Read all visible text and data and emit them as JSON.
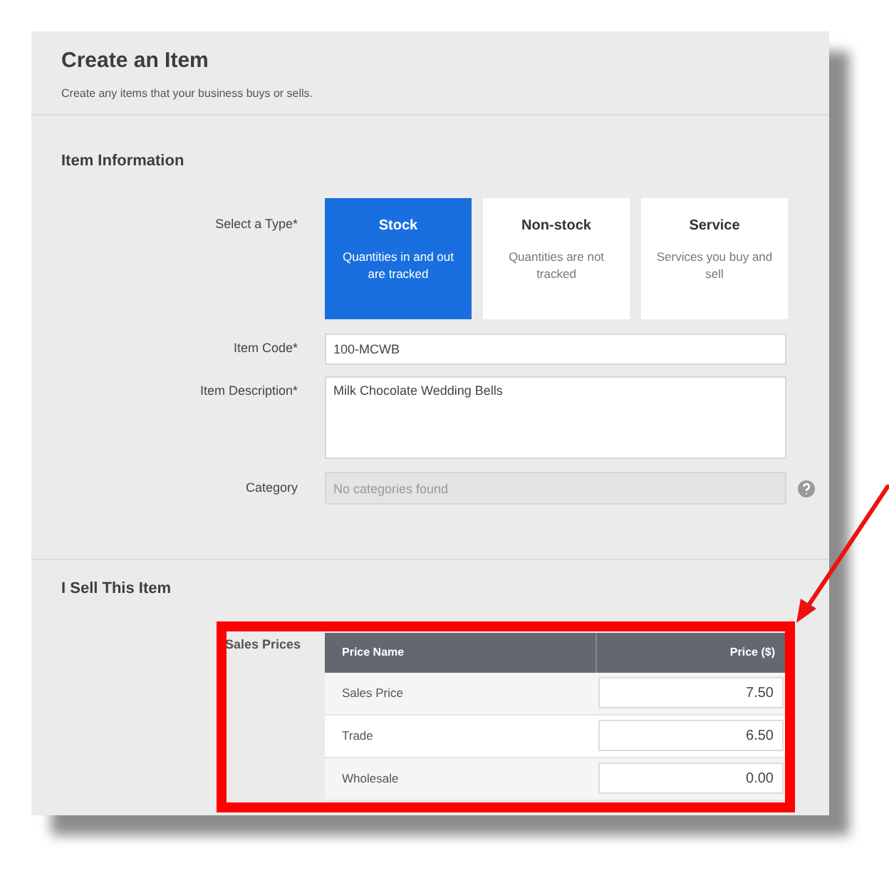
{
  "header": {
    "title": "Create an Item",
    "subtitle": "Create any items that your business buys or sells."
  },
  "item_information": {
    "heading": "Item Information",
    "type_label": "Select a Type*",
    "types": [
      {
        "title": "Stock",
        "description": "Quantities in and out are tracked",
        "selected": true
      },
      {
        "title": "Non-stock",
        "description": "Quantities are not tracked",
        "selected": false
      },
      {
        "title": "Service",
        "description": "Services you buy and sell",
        "selected": false
      }
    ],
    "item_code": {
      "label": "Item Code*",
      "value": "100-MCWB"
    },
    "item_description": {
      "label": "Item Description*",
      "value": "Milk Chocolate Wedding Bells"
    },
    "category": {
      "label": "Category",
      "placeholder": "No categories found",
      "disabled": true
    }
  },
  "sell_section": {
    "heading": "I Sell This Item",
    "label": "Sales Prices",
    "table": {
      "columns": [
        "Price Name",
        "Price ($)"
      ],
      "rows": [
        {
          "name": "Sales Price",
          "price": "7.50"
        },
        {
          "name": "Trade",
          "price": "6.50"
        },
        {
          "name": "Wholesale",
          "price": "0.00"
        }
      ]
    }
  }
}
